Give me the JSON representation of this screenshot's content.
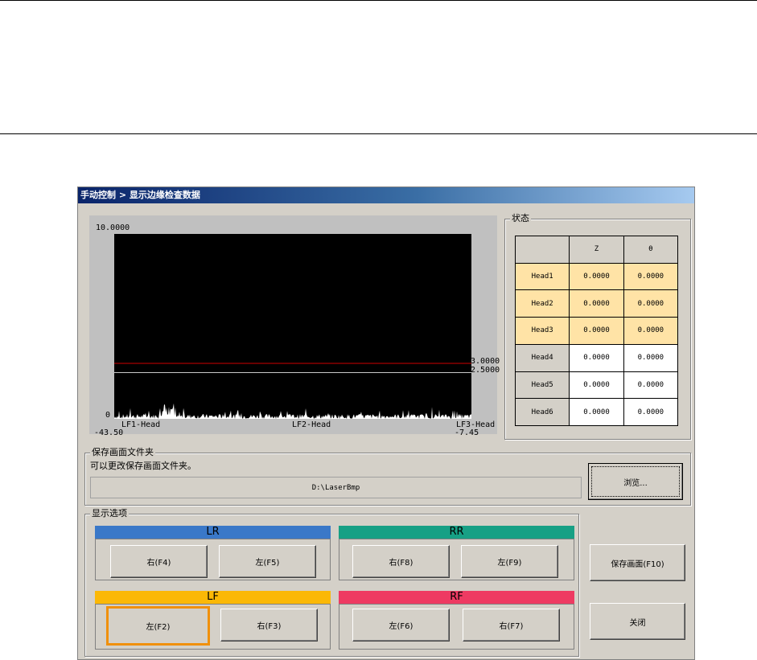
{
  "window": {
    "title": "手动控制 > 显示边缘检查数据"
  },
  "chart_data": {
    "type": "area",
    "y_top_label": "10.0000",
    "y_bottom_label": "0",
    "x_min_label": "-43.50",
    "x_max_label": "-7.45",
    "x_markers": [
      "LF1-Head",
      "LF2-Head",
      "LF3-Head"
    ],
    "ylim": [
      0,
      10
    ],
    "thresholds": [
      {
        "label": "3.0000",
        "value": 3.0,
        "color": "#d00000"
      },
      {
        "label": "2.5000",
        "value": 2.5,
        "color": "#c8c8c8"
      }
    ]
  },
  "status": {
    "title": "状态",
    "columns": [
      "",
      "Z",
      "θ"
    ],
    "rows": [
      {
        "name": "Head1",
        "z": "0.0000",
        "theta": "0.0000",
        "highlight": true
      },
      {
        "name": "Head2",
        "z": "0.0000",
        "theta": "0.0000",
        "highlight": true
      },
      {
        "name": "Head3",
        "z": "0.0000",
        "theta": "0.0000",
        "highlight": true
      },
      {
        "name": "Head4",
        "z": "0.0000",
        "theta": "0.0000",
        "highlight": false
      },
      {
        "name": "Head5",
        "z": "0.0000",
        "theta": "0.0000",
        "highlight": false
      },
      {
        "name": "Head6",
        "z": "0.0000",
        "theta": "0.0000",
        "highlight": false
      }
    ]
  },
  "save_folder": {
    "title": "保存画面文件夹",
    "description": "可以更改保存画面文件夹。",
    "path": "D:\\LaserBmp",
    "browse_label": "浏览..."
  },
  "display_options": {
    "title": "显示选项",
    "lr": {
      "label": "LR",
      "color": "#3a78c8",
      "right": "右(F4)",
      "left": "左(F5)"
    },
    "rr": {
      "label": "RR",
      "color": "#17a085",
      "right": "右(F8)",
      "left": "左(F9)"
    },
    "lf": {
      "label": "LF",
      "color": "#fbb806",
      "left": "左(F2)",
      "right": "右(F3)"
    },
    "rf": {
      "label": "RF",
      "color": "#ee3a62",
      "left": "左(F6)",
      "right": "右(F7)"
    }
  },
  "actions": {
    "save_screen": "保存画面(F10)",
    "close": "关闭"
  }
}
